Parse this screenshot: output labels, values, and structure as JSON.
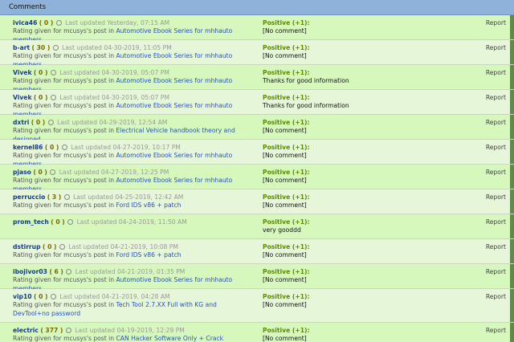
{
  "header": {
    "title": "Comments"
  },
  "report_label": "Report",
  "rows": [
    {
      "user": "ivica46",
      "rep": "( 0 )",
      "updated": "Last updated Yesterday, 07:15 AM",
      "given": "Rating given for mcusys's post in",
      "thread": "Automotive Ebook Series for mhhauto members",
      "rating": "Positive (+1):",
      "comment": "[No comment]"
    },
    {
      "user": "b-art",
      "rep": "( 30 )",
      "updated": "Last updated 04-30-2019, 11:05 PM",
      "given": "Rating given for mcusys's post in",
      "thread": "Automotive Ebook Series for mhhauto members",
      "rating": "Positive (+1):",
      "comment": "[No comment]"
    },
    {
      "user": "Vivek",
      "rep": "( 0 )",
      "updated": "Last updated 04-30-2019, 05:07 PM",
      "given": "Rating given for mcusys's post in",
      "thread": "Automotive Ebook Series for mhhauto members",
      "rating": "Positive (+1):",
      "comment": "Thanks for good information"
    },
    {
      "user": "Vivek",
      "rep": "( 0 )",
      "updated": "Last updated 04-30-2019, 05:07 PM",
      "given": "Rating given for mcusys's post in",
      "thread": "Automotive Ebook Series for mhhauto members",
      "rating": "Positive (+1):",
      "comment": "Thanks for good information"
    },
    {
      "user": "dxtri",
      "rep": "( 0 )",
      "updated": "Last updated 04-29-2019, 12:54 AM",
      "given": "Rating given for mcusys's post in",
      "thread": "Electrical Vehicle handbook theory and designed",
      "rating": "Positive (+1):",
      "comment": "[No comment]"
    },
    {
      "user": "kernel86",
      "rep": "( 0 )",
      "updated": "Last updated 04-27-2019, 10:17 PM",
      "given": "Rating given for mcusys's post in",
      "thread": "Automotive Ebook Series for mhhauto members",
      "rating": "Positive (+1):",
      "comment": "[No comment]"
    },
    {
      "user": "pjaso",
      "rep": "( 0 )",
      "updated": "Last updated 04-27-2019, 12:25 PM",
      "given": "Rating given for mcusys's post in",
      "thread": "Automotive Ebook Series for mhhauto members",
      "rating": "Positive (+1):",
      "comment": "[No comment]"
    },
    {
      "user": "perruccio",
      "rep": "( 3 )",
      "updated": "Last updated 04-25-2019, 12:42 AM",
      "given": "Rating given for mcusys's post in",
      "thread": "Ford IDS v86 + patch",
      "rating": "Positive (+1):",
      "comment": "[No comment]"
    },
    {
      "user": "prom_tech",
      "rep": "( 0 )",
      "updated": "Last updated 04-24-2019, 11:50 AM",
      "given": "",
      "thread": "",
      "rating": "Positive (+1):",
      "comment": "very gooddd"
    },
    {
      "user": "dstirrup",
      "rep": "( 0 )",
      "updated": "Last updated 04-21-2019, 10:08 PM",
      "given": "Rating given for mcusys's post in",
      "thread": "Ford IDS v86 + patch",
      "rating": "Positive (+1):",
      "comment": "[No comment]"
    },
    {
      "user": "ibojivor03",
      "rep": "( 6 )",
      "updated": "Last updated 04-21-2019, 01:35 PM",
      "given": "Rating given for mcusys's post in",
      "thread": "Automotive Ebook Series for mhhauto members",
      "rating": "Positive (+1):",
      "comment": "[No comment]"
    },
    {
      "user": "vip10",
      "rep": "( 0 )",
      "updated": "Last updated 04-21-2019, 04:28 AM",
      "given": "Rating given for mcusys's post in",
      "thread": "Tech Tool 2.7.XX Full with KG and DevTool+no password",
      "rating": "Positive (+1):",
      "comment": "[No comment]"
    },
    {
      "user": "electric",
      "rep": "( 377 )",
      "updated": "Last updated 04-19-2019, 12:29 PM",
      "given": "Rating given for mcusys's post in",
      "thread": "CAN Hacker Software Only + Crack",
      "rating": "Positive (+1):",
      "comment": "[No comment]"
    }
  ]
}
